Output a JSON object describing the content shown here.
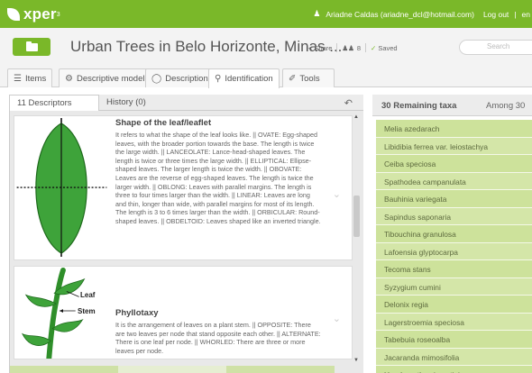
{
  "brand": {
    "name": "xper",
    "registered": "3"
  },
  "top_bar": {
    "user_label": "Ariadne Caldas (ariadne_dcl@hotmail.com)",
    "logout_label": "Log out",
    "separator": "|",
    "language": "en"
  },
  "title_row": {
    "title": "Urban Trees in Belo Horizonte, Minas ...",
    "share_label": "Share",
    "users_count": "8",
    "saved_label": "Saved",
    "search_placeholder": "Search"
  },
  "tabs": [
    {
      "label": "Items",
      "icon": "list-icon"
    },
    {
      "label": "Descriptive model",
      "icon": "gears-icon"
    },
    {
      "label": "Description",
      "icon": "speech-bubble-icon"
    },
    {
      "label": "Identification",
      "icon": "search-icon",
      "active": true
    },
    {
      "label": "Tools",
      "icon": "tools-icon"
    }
  ],
  "left_panel": {
    "descriptors_tab": "11 Descriptors",
    "history_tab": "History (0)",
    "descriptors": [
      {
        "title": "Shape of the leaf/leaflet",
        "text": "It refers to what the shape of the leaf looks like. || OVATE: Egg-shaped leaves, with the broader portion towards the base. The length is twice the large width. || LANCEOLATE: Lance-head-shaped leaves. The length is twice or three times the large width. || ELLIPTICAL: Ellipse-shaped leaves. The larger length is twice the width. || OBOVATE: Leaves are the reverse of egg-shaped leaves. The length is twice the larger width. || OBLONG: Leaves with parallel margins. The length is three to four times larger than the width. || LINEAR: Leaves are long and thin, longer than wide, with parallel margins for most of its length. The length is 3 to 6 times larger than the width. || ORBICULAR: Round-shaped leaves. || OBDELTOID: Leaves shaped like an inverted triangle.",
        "image": "leaf-shape-illustration"
      },
      {
        "title": "Phyllotaxy",
        "text": "It is the arrangement of leaves on a plant stem. || OPPOSITE: There are two leaves per node that stand opposite each other. || ALTERNATE: There is one leaf per node. || WHORLED: There are three or more leaves per node.",
        "image": "phyllotaxy-illustration",
        "image_labels": {
          "leaf": "Leaf",
          "stem": "Stem"
        }
      }
    ]
  },
  "right_panel": {
    "title": "30 Remaining taxa",
    "among": "Among 30",
    "taxa": [
      "Melia azedarach",
      "Libidibia ferrea var. leiostachya",
      "Ceiba speciosa",
      "Spathodea campanulata",
      "Bauhinia variegata",
      "Sapindus saponaria",
      "Tibouchina granulosa",
      "Lafoensia glyptocarpa",
      "Tecoma stans",
      "Syzygium cumini",
      "Delonix regia",
      "Lagerstroemia speciosa",
      "Tabebuia roseoalba",
      "Jacaranda mimosifolia",
      "Handroanthus impetiginosus"
    ]
  },
  "colors": {
    "brand_green": "#7ab829",
    "leaf_green": "#3ea33a",
    "taxa_row": "#d4e6a8"
  }
}
